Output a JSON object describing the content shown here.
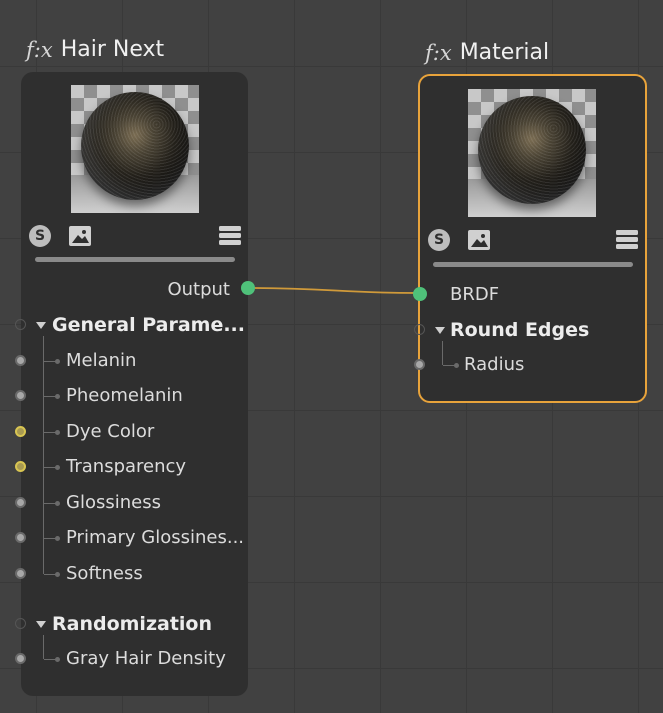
{
  "hair_node": {
    "title": "Hair Next",
    "fx_symbol": "f:x",
    "output_label": "Output",
    "groups": [
      {
        "label": "General Parame...",
        "items": [
          {
            "label": "Melanin",
            "port": "grey"
          },
          {
            "label": "Pheomelanin",
            "port": "grey"
          },
          {
            "label": "Dye Color",
            "port": "yellow"
          },
          {
            "label": "Transparency",
            "port": "yellow"
          },
          {
            "label": "Glossiness",
            "port": "grey"
          },
          {
            "label": "Primary Glossines...",
            "port": "grey"
          },
          {
            "label": "Softness",
            "port": "grey"
          }
        ]
      },
      {
        "label": "Randomization",
        "items": [
          {
            "label": "Gray Hair Density",
            "port": "grey"
          }
        ]
      }
    ],
    "icons": [
      "s-badge-icon",
      "image-icon",
      "menu-icon"
    ]
  },
  "material_node": {
    "title": "Material",
    "fx_symbol": "f:x",
    "input_label": "BRDF",
    "groups": [
      {
        "label": "Round Edges",
        "items": [
          {
            "label": "Radius",
            "port": "grey"
          }
        ]
      }
    ],
    "icons": [
      "s-badge-icon",
      "image-icon",
      "menu-icon"
    ]
  },
  "colors": {
    "selected_border": "#e8a33b",
    "wire": "#d09a3a",
    "port_green": "#4fc17a",
    "port_yellow": "#d8c552",
    "node_bg": "#2f2f2f",
    "canvas_bg": "#414141"
  }
}
